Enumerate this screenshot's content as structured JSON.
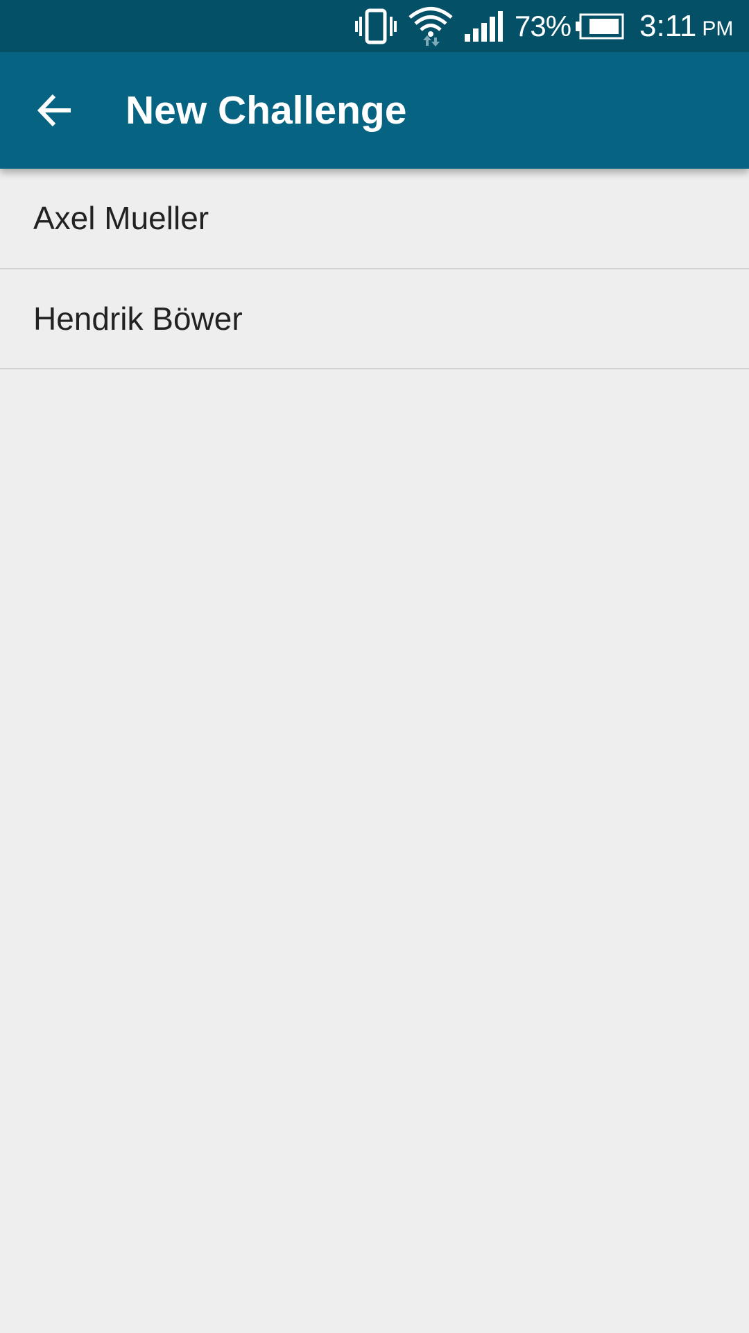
{
  "status_bar": {
    "icons": [
      "vibrate-icon",
      "wifi-icon",
      "signal-icon",
      "battery-icon"
    ],
    "battery_percent": "73%",
    "time": "3:11",
    "ampm": "PM"
  },
  "app_bar": {
    "back_icon": "arrow-back-icon",
    "title": "New Challenge",
    "color": "#066482"
  },
  "contacts": [
    {
      "name": "Axel Mueller"
    },
    {
      "name": "Hendrik Böwer"
    }
  ]
}
